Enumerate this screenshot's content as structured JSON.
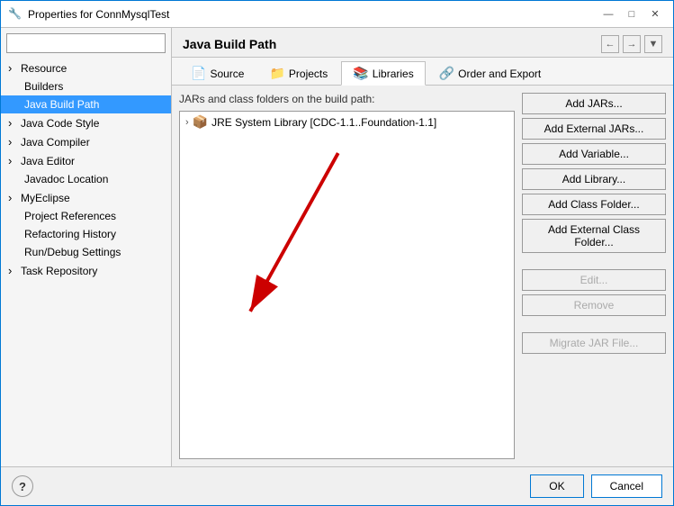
{
  "window": {
    "title": "Properties for ConnMysqlTest",
    "icon": "🔧"
  },
  "titlebar": {
    "minimize_label": "—",
    "maximize_label": "□",
    "close_label": "✕"
  },
  "search": {
    "placeholder": ""
  },
  "sidebar": {
    "items": [
      {
        "id": "resource",
        "label": "Resource",
        "hasArrow": true,
        "selected": false
      },
      {
        "id": "builders",
        "label": "Builders",
        "hasArrow": false,
        "selected": false
      },
      {
        "id": "java-build-path",
        "label": "Java Build Path",
        "hasArrow": false,
        "selected": true
      },
      {
        "id": "java-code-style",
        "label": "Java Code Style",
        "hasArrow": true,
        "selected": false
      },
      {
        "id": "java-compiler",
        "label": "Java Compiler",
        "hasArrow": true,
        "selected": false
      },
      {
        "id": "java-editor",
        "label": "Java Editor",
        "hasArrow": true,
        "selected": false
      },
      {
        "id": "javadoc-location",
        "label": "Javadoc Location",
        "hasArrow": false,
        "selected": false
      },
      {
        "id": "myeclipse",
        "label": "MyEclipse",
        "hasArrow": true,
        "selected": false
      },
      {
        "id": "project-references",
        "label": "Project References",
        "hasArrow": false,
        "selected": false
      },
      {
        "id": "refactoring-history",
        "label": "Refactoring History",
        "hasArrow": false,
        "selected": false
      },
      {
        "id": "run-debug-settings",
        "label": "Run/Debug Settings",
        "hasArrow": false,
        "selected": false
      },
      {
        "id": "task-repository",
        "label": "Task Repository",
        "hasArrow": true,
        "selected": false
      }
    ]
  },
  "content": {
    "title": "Java Build Path",
    "description": "JARs and class folders on the build path:",
    "tabs": [
      {
        "id": "source",
        "label": "Source",
        "icon": "📄",
        "active": false
      },
      {
        "id": "projects",
        "label": "Projects",
        "icon": "📁",
        "active": false
      },
      {
        "id": "libraries",
        "label": "Libraries",
        "icon": "📚",
        "active": true
      },
      {
        "id": "order-export",
        "label": "Order and Export",
        "icon": "🔗",
        "active": false
      }
    ],
    "tree_items": [
      {
        "id": "jre-system",
        "label": "JRE System Library [CDC-1.1..Foundation-1.1]",
        "expanded": false
      }
    ],
    "buttons": [
      {
        "id": "add-jars",
        "label": "Add JARs...",
        "disabled": false
      },
      {
        "id": "add-external-jars",
        "label": "Add External JARs...",
        "disabled": false
      },
      {
        "id": "add-variable",
        "label": "Add Variable...",
        "disabled": false
      },
      {
        "id": "add-library",
        "label": "Add Library...",
        "disabled": false
      },
      {
        "id": "add-class-folder",
        "label": "Add Class Folder...",
        "disabled": false
      },
      {
        "id": "add-external-class-folder",
        "label": "Add External Class Folder...",
        "disabled": false
      },
      {
        "spacer": true
      },
      {
        "id": "edit",
        "label": "Edit...",
        "disabled": true
      },
      {
        "id": "remove",
        "label": "Remove",
        "disabled": true
      },
      {
        "spacer": true
      },
      {
        "id": "migrate-jar",
        "label": "Migrate JAR File...",
        "disabled": true
      }
    ]
  },
  "footer": {
    "help_label": "?",
    "ok_label": "OK",
    "cancel_label": "Cancel"
  }
}
